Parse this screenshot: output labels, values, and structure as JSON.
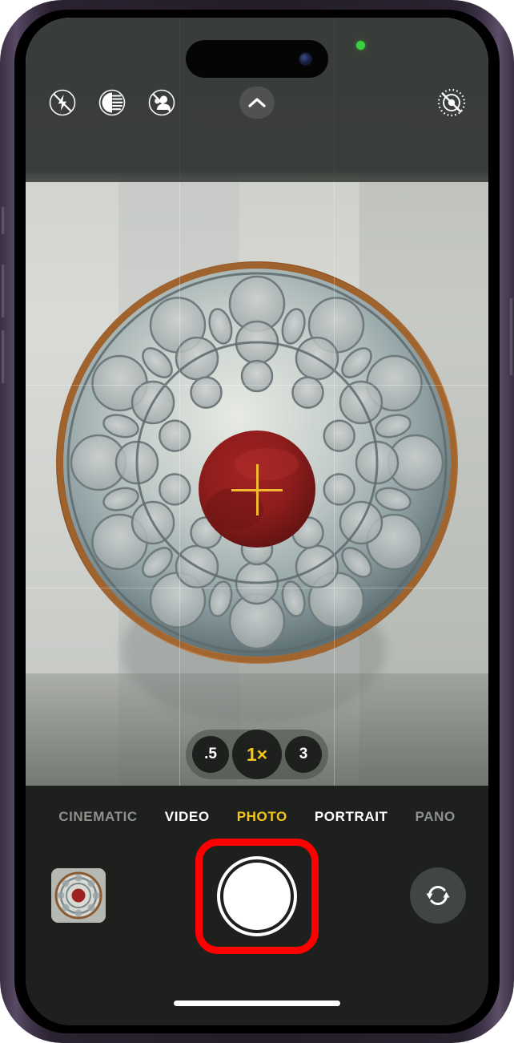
{
  "app": {
    "name": "Camera",
    "platform": "iOS"
  },
  "status": {
    "camera_in_use_indicator": "green-dot",
    "dynamic_island": "dynamic-island"
  },
  "top_controls": {
    "items": [
      {
        "name": "flash-off-icon",
        "label": "Flash Off",
        "state": "off"
      },
      {
        "name": "night-mode-icon",
        "label": "Night Mode",
        "state": "available"
      },
      {
        "name": "portrait-off-icon",
        "label": "Portrait Lighting Off",
        "state": "off"
      },
      {
        "name": "live-photo-off-icon",
        "label": "Live Photo Off",
        "state": "off"
      }
    ],
    "expand_label": "Show Camera Controls",
    "expand_icon": "chevron-up-icon"
  },
  "viewfinder": {
    "subject": "Ornate openwork ceramic plate with red center",
    "focus_indicator": "crosshair",
    "focus_color": "#f4b731",
    "grid_enabled": true
  },
  "zoom": {
    "options": [
      {
        "label": ".5",
        "value": "0.5x",
        "selected": false
      },
      {
        "label": "1×",
        "value": "1x",
        "selected": true
      },
      {
        "label": "3",
        "value": "3x",
        "selected": false
      }
    ],
    "selected_label": "1×",
    "active_color": "#f5c518"
  },
  "modes": {
    "items": [
      {
        "label": "CINEMATIC",
        "selected": false,
        "dim": true
      },
      {
        "label": "VIDEO",
        "selected": false,
        "dim": false
      },
      {
        "label": "PHOTO",
        "selected": true,
        "dim": false
      },
      {
        "label": "PORTRAIT",
        "selected": false,
        "dim": false
      },
      {
        "label": "PANO",
        "selected": false,
        "dim": true
      }
    ],
    "selected": "PHOTO",
    "selected_color": "#f5c518"
  },
  "bottom_bar": {
    "thumbnail_label": "Photo Library Thumbnail",
    "shutter_label": "Take Photo",
    "flip_label": "Switch Camera",
    "flip_icon": "camera-flip-icon"
  },
  "annotation": {
    "target": "shutter-button",
    "shape": "rounded-rectangle",
    "color": "#fe0000",
    "stroke_width": "9px"
  },
  "device": {
    "frame_color": "#3b2f44",
    "home_indicator": "home-indicator"
  }
}
